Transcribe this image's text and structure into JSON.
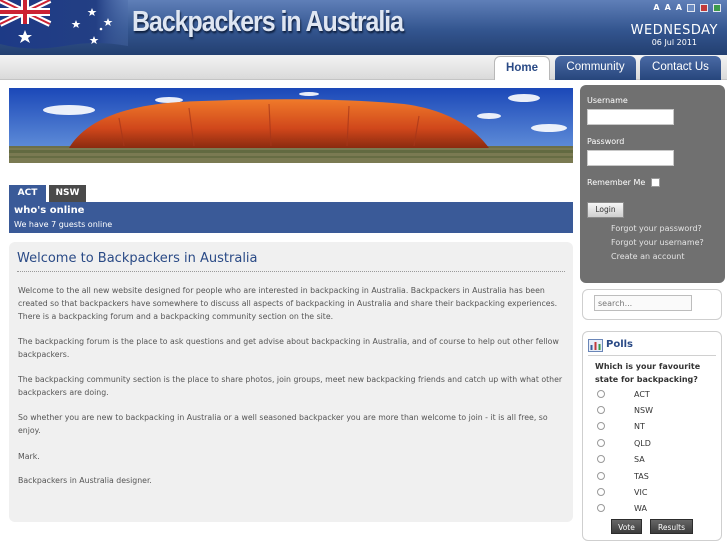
{
  "header": {
    "site_title": "Backpackers in Australia",
    "day": "WEDNESDAY",
    "date": "06 Jul 2011",
    "font_size_tools": [
      "A",
      "A",
      "A"
    ]
  },
  "nav": {
    "tabs": [
      {
        "label": "Home",
        "active": true
      },
      {
        "label": "Community",
        "active": false
      },
      {
        "label": "Contact Us",
        "active": false
      }
    ]
  },
  "state_tabs": [
    "ACT",
    "NSW"
  ],
  "whos_online": {
    "title": "who's online",
    "text": "We have 7 guests online"
  },
  "article": {
    "title": "Welcome to Backpackers in Australia",
    "paragraphs": [
      "Welcome to the all new website designed for people who are interested in backpacking in Australia. Backpackers in Australia has been created so that backpackers have somewhere to discuss all aspects of backpacking in Australia and share their backpacking experiences. There is a backpacking forum and a backpacking community section on the site.",
      "The backpacking forum  is the place to ask questions and get advise about backpacking in Australia, and of course to help out other fellow backpackers.",
      "The backpacking community section is the place to share photos, join groups, meet new backpacking friends and  catch up with what other backpackers are doing.",
      "So whether you are new to backpacking in Australia or a well seasoned backpacker  you are more than welcome to join - it is all free, so enjoy.",
      "Mark.",
      "Backpackers in Australia designer."
    ]
  },
  "login": {
    "username_label": "Username",
    "password_label": "Password",
    "remember_label": "Remember Me",
    "button": "Login",
    "forgot_password": "Forgot your password?",
    "forgot_username": "Forgot your username?",
    "create_account": "Create an account"
  },
  "search": {
    "placeholder": "search..."
  },
  "polls": {
    "title": "Polls",
    "question": "Which is your favourite state for backpacking?",
    "options": [
      "ACT",
      "NSW",
      "NT",
      "QLD",
      "SA",
      "TAS",
      "VIC",
      "WA"
    ],
    "vote_button": "Vote",
    "results_button": "Results"
  },
  "colors": {
    "brand_blue": "#3a5a98",
    "header_dark": "#233f70",
    "login_panel": "#707070"
  }
}
